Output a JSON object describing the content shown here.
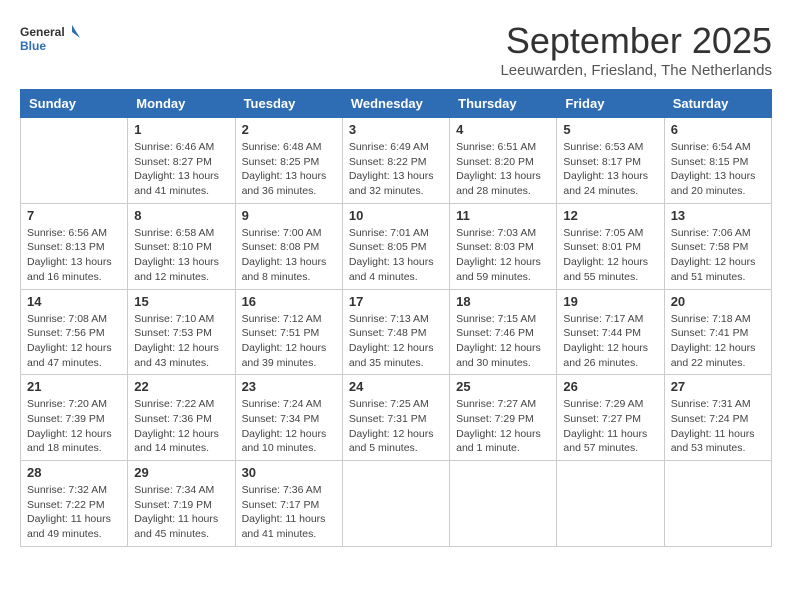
{
  "header": {
    "logo_general": "General",
    "logo_blue": "Blue",
    "month": "September 2025",
    "location": "Leeuwarden, Friesland, The Netherlands"
  },
  "weekdays": [
    "Sunday",
    "Monday",
    "Tuesday",
    "Wednesday",
    "Thursday",
    "Friday",
    "Saturday"
  ],
  "weeks": [
    [
      {
        "day": "",
        "info": ""
      },
      {
        "day": "1",
        "info": "Sunrise: 6:46 AM\nSunset: 8:27 PM\nDaylight: 13 hours\nand 41 minutes."
      },
      {
        "day": "2",
        "info": "Sunrise: 6:48 AM\nSunset: 8:25 PM\nDaylight: 13 hours\nand 36 minutes."
      },
      {
        "day": "3",
        "info": "Sunrise: 6:49 AM\nSunset: 8:22 PM\nDaylight: 13 hours\nand 32 minutes."
      },
      {
        "day": "4",
        "info": "Sunrise: 6:51 AM\nSunset: 8:20 PM\nDaylight: 13 hours\nand 28 minutes."
      },
      {
        "day": "5",
        "info": "Sunrise: 6:53 AM\nSunset: 8:17 PM\nDaylight: 13 hours\nand 24 minutes."
      },
      {
        "day": "6",
        "info": "Sunrise: 6:54 AM\nSunset: 8:15 PM\nDaylight: 13 hours\nand 20 minutes."
      }
    ],
    [
      {
        "day": "7",
        "info": "Sunrise: 6:56 AM\nSunset: 8:13 PM\nDaylight: 13 hours\nand 16 minutes."
      },
      {
        "day": "8",
        "info": "Sunrise: 6:58 AM\nSunset: 8:10 PM\nDaylight: 13 hours\nand 12 minutes."
      },
      {
        "day": "9",
        "info": "Sunrise: 7:00 AM\nSunset: 8:08 PM\nDaylight: 13 hours\nand 8 minutes."
      },
      {
        "day": "10",
        "info": "Sunrise: 7:01 AM\nSunset: 8:05 PM\nDaylight: 13 hours\nand 4 minutes."
      },
      {
        "day": "11",
        "info": "Sunrise: 7:03 AM\nSunset: 8:03 PM\nDaylight: 12 hours\nand 59 minutes."
      },
      {
        "day": "12",
        "info": "Sunrise: 7:05 AM\nSunset: 8:01 PM\nDaylight: 12 hours\nand 55 minutes."
      },
      {
        "day": "13",
        "info": "Sunrise: 7:06 AM\nSunset: 7:58 PM\nDaylight: 12 hours\nand 51 minutes."
      }
    ],
    [
      {
        "day": "14",
        "info": "Sunrise: 7:08 AM\nSunset: 7:56 PM\nDaylight: 12 hours\nand 47 minutes."
      },
      {
        "day": "15",
        "info": "Sunrise: 7:10 AM\nSunset: 7:53 PM\nDaylight: 12 hours\nand 43 minutes."
      },
      {
        "day": "16",
        "info": "Sunrise: 7:12 AM\nSunset: 7:51 PM\nDaylight: 12 hours\nand 39 minutes."
      },
      {
        "day": "17",
        "info": "Sunrise: 7:13 AM\nSunset: 7:48 PM\nDaylight: 12 hours\nand 35 minutes."
      },
      {
        "day": "18",
        "info": "Sunrise: 7:15 AM\nSunset: 7:46 PM\nDaylight: 12 hours\nand 30 minutes."
      },
      {
        "day": "19",
        "info": "Sunrise: 7:17 AM\nSunset: 7:44 PM\nDaylight: 12 hours\nand 26 minutes."
      },
      {
        "day": "20",
        "info": "Sunrise: 7:18 AM\nSunset: 7:41 PM\nDaylight: 12 hours\nand 22 minutes."
      }
    ],
    [
      {
        "day": "21",
        "info": "Sunrise: 7:20 AM\nSunset: 7:39 PM\nDaylight: 12 hours\nand 18 minutes."
      },
      {
        "day": "22",
        "info": "Sunrise: 7:22 AM\nSunset: 7:36 PM\nDaylight: 12 hours\nand 14 minutes."
      },
      {
        "day": "23",
        "info": "Sunrise: 7:24 AM\nSunset: 7:34 PM\nDaylight: 12 hours\nand 10 minutes."
      },
      {
        "day": "24",
        "info": "Sunrise: 7:25 AM\nSunset: 7:31 PM\nDaylight: 12 hours\nand 5 minutes."
      },
      {
        "day": "25",
        "info": "Sunrise: 7:27 AM\nSunset: 7:29 PM\nDaylight: 12 hours\nand 1 minute."
      },
      {
        "day": "26",
        "info": "Sunrise: 7:29 AM\nSunset: 7:27 PM\nDaylight: 11 hours\nand 57 minutes."
      },
      {
        "day": "27",
        "info": "Sunrise: 7:31 AM\nSunset: 7:24 PM\nDaylight: 11 hours\nand 53 minutes."
      }
    ],
    [
      {
        "day": "28",
        "info": "Sunrise: 7:32 AM\nSunset: 7:22 PM\nDaylight: 11 hours\nand 49 minutes."
      },
      {
        "day": "29",
        "info": "Sunrise: 7:34 AM\nSunset: 7:19 PM\nDaylight: 11 hours\nand 45 minutes."
      },
      {
        "day": "30",
        "info": "Sunrise: 7:36 AM\nSunset: 7:17 PM\nDaylight: 11 hours\nand 41 minutes."
      },
      {
        "day": "",
        "info": ""
      },
      {
        "day": "",
        "info": ""
      },
      {
        "day": "",
        "info": ""
      },
      {
        "day": "",
        "info": ""
      }
    ]
  ]
}
